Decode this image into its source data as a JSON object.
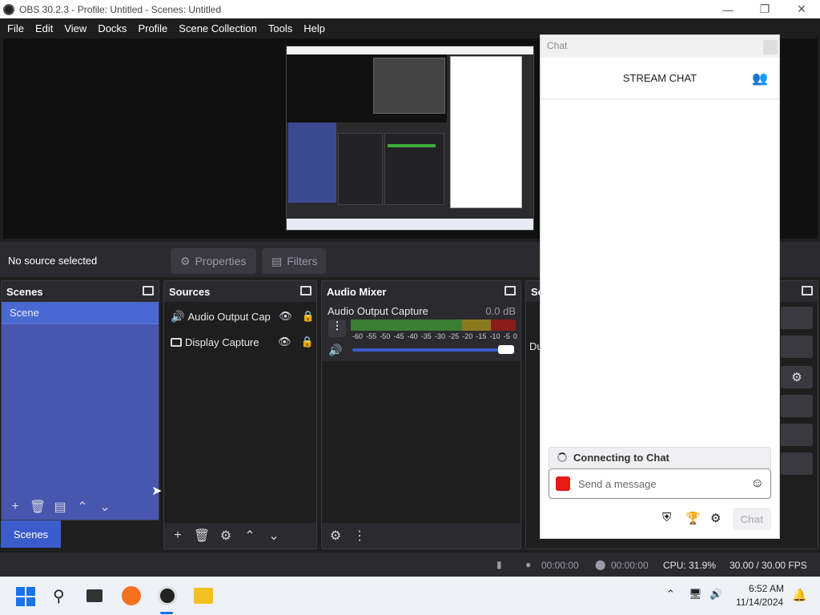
{
  "window": {
    "title": "OBS 30.2.3 - Profile: Untitled - Scenes: Untitled"
  },
  "menu": [
    "File",
    "Edit",
    "View",
    "Docks",
    "Profile",
    "Scene Collection",
    "Tools",
    "Help"
  ],
  "toolbar": {
    "no_source": "No source selected",
    "properties": "Properties",
    "filters": "Filters"
  },
  "scenes": {
    "title": "Scenes",
    "items": [
      "Scene"
    ],
    "tab": "Scenes"
  },
  "sources": {
    "title": "Sources",
    "items": [
      "Audio Output Cap",
      "Display Capture"
    ]
  },
  "mixer": {
    "title": "Audio Mixer",
    "channel": "Audio Output Capture",
    "db": "0.0 dB",
    "scale": [
      "-60",
      "-55",
      "-50",
      "-45",
      "-40",
      "-35",
      "-30",
      "-25",
      "-20",
      "-15",
      "-10",
      "-5",
      "0"
    ],
    "volume_fraction": 1.0
  },
  "partial_dock": {
    "title": "Sc",
    "label": "Du"
  },
  "chat": {
    "window_title": "Chat",
    "header": "STREAM CHAT",
    "status": "Connecting to Chat",
    "placeholder": "Send a message",
    "send_label": "Chat"
  },
  "status": {
    "stream_time": "00:00:00",
    "rec_time": "00:00:00",
    "cpu": "CPU: 31.9%",
    "fps": "30.00 / 30.00 FPS"
  },
  "taskbar": {
    "time": "6:52 AM",
    "date": "11/14/2024"
  },
  "colors": {
    "accent": "#3b5ccd",
    "scene_selected": "#4a68d1",
    "dock_bg": "#1f1e1f",
    "scene_list_bg": "#4856b0"
  }
}
